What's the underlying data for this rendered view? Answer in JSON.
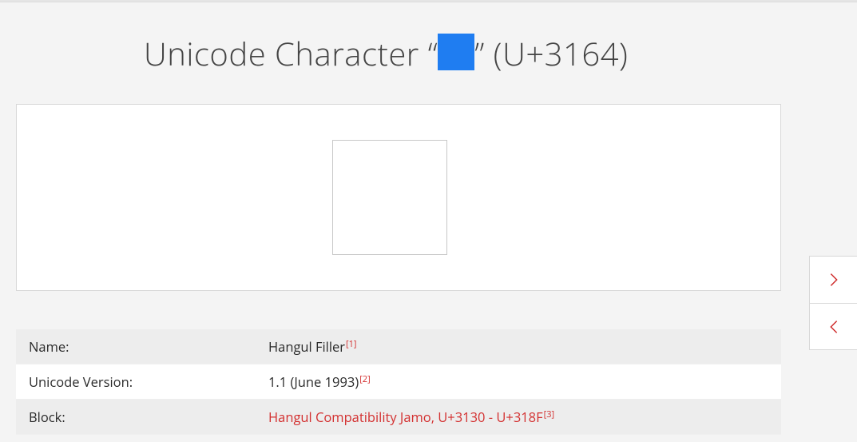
{
  "title": {
    "prefix": "Unicode Character “",
    "suffix": "” (U+3164)"
  },
  "props": [
    {
      "label": "Name:",
      "value": "Hangul Filler",
      "ref": "[1]",
      "link": false
    },
    {
      "label": "Unicode Version:",
      "value": "1.1 (June 1993)",
      "ref": "[2]",
      "link": false
    },
    {
      "label": "Block:",
      "value": "Hangul Compatibility Jamo, U+3130 - U+318F",
      "ref": "[3]",
      "link": true
    }
  ]
}
